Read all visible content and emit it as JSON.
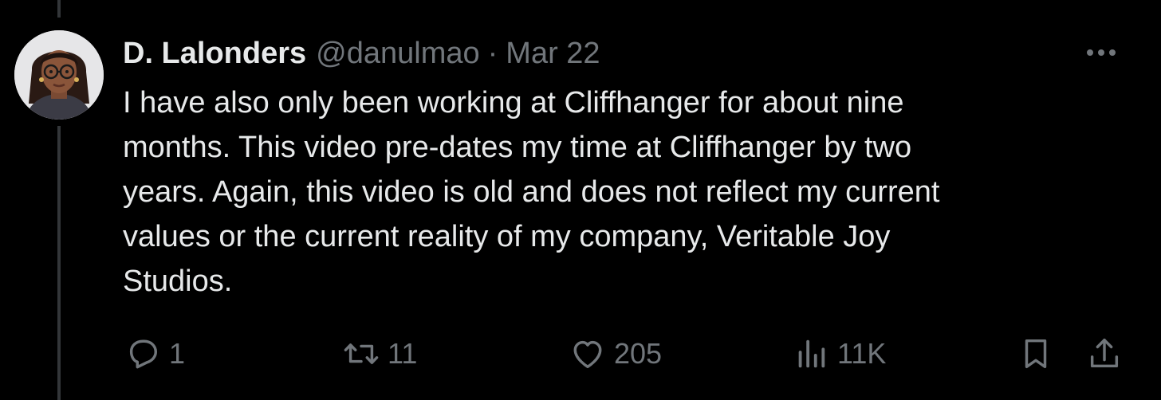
{
  "tweet": {
    "author": {
      "display_name": "D. Lalonders",
      "handle": "@danulmao",
      "avatar_icon": "avatar-illustration"
    },
    "separator": "·",
    "date": "Mar 22",
    "text": "I have also only been working at Cliffhanger for about nine\nmonths. This video pre-dates my time at Cliffhanger by two\nyears. Again, this video is old and does not reflect my current\nvalues or the current reality of my company, Veritable Joy\nStudios.",
    "more_icon": "more-icon"
  },
  "actions": {
    "reply": {
      "icon": "reply-icon",
      "count": "1"
    },
    "retweet": {
      "icon": "retweet-icon",
      "count": "11"
    },
    "like": {
      "icon": "heart-icon",
      "count": "205"
    },
    "views": {
      "icon": "views-icon",
      "count": "11K"
    },
    "bookmark": {
      "icon": "bookmark-icon"
    },
    "share": {
      "icon": "share-icon"
    }
  },
  "colors": {
    "background": "#000000",
    "primary_text": "#e7e9ea",
    "secondary_text": "#71767b",
    "thread_line": "#333639"
  }
}
